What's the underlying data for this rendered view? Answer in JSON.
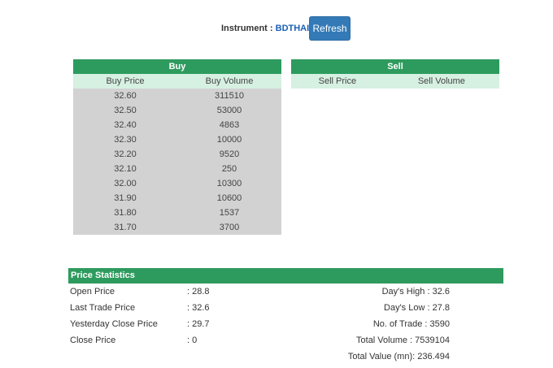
{
  "instrument": {
    "label": "Instrument :",
    "value": "BDTHAI"
  },
  "refresh_label": "Refresh",
  "buy": {
    "title": "Buy",
    "col_price": "Buy Price",
    "col_volume": "Buy Volume",
    "rows": [
      {
        "price": "32.60",
        "volume": "311510"
      },
      {
        "price": "32.50",
        "volume": "53000"
      },
      {
        "price": "32.40",
        "volume": "4863"
      },
      {
        "price": "32.30",
        "volume": "10000"
      },
      {
        "price": "32.20",
        "volume": "9520"
      },
      {
        "price": "32.10",
        "volume": "250"
      },
      {
        "price": "32.00",
        "volume": "10300"
      },
      {
        "price": "31.90",
        "volume": "10600"
      },
      {
        "price": "31.80",
        "volume": "1537"
      },
      {
        "price": "31.70",
        "volume": "3700"
      }
    ]
  },
  "sell": {
    "title": "Sell",
    "col_price": "Sell Price",
    "col_volume": "Sell Volume"
  },
  "stats": {
    "title": "Price Statistics",
    "left": [
      {
        "label": "Open Price",
        "value": ": 28.8"
      },
      {
        "label": "Last Trade Price",
        "value": ": 32.6"
      },
      {
        "label": "Yesterday Close Price",
        "value": ": 29.7"
      },
      {
        "label": "Close Price",
        "value": ": 0"
      }
    ],
    "right": [
      "Day's High : 32.6",
      "Day's Low : 27.8",
      "No. of Trade : 3590",
      "Total Volume : 7539104",
      "Total Value (mn): 236.494"
    ]
  }
}
